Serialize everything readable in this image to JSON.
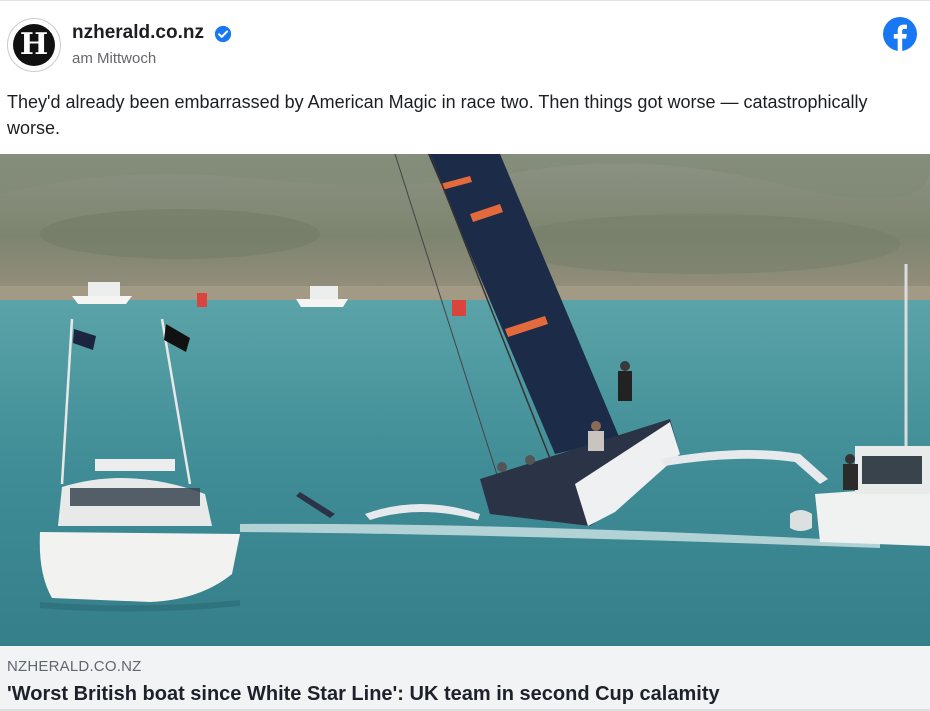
{
  "post": {
    "page_name": "nzherald.co.nz",
    "timestamp": "am Mittwoch",
    "avatar_letter": "H",
    "message": "They'd already been embarrassed by American Magic in race two. Then things got worse — catastrophically worse.",
    "icons": {
      "verified": "verified-badge-icon",
      "platform": "facebook-logo-icon"
    },
    "colors": {
      "verified": "#1877f2",
      "facebook": "#1877f2",
      "footer_bg": "#f2f3f5"
    }
  },
  "link": {
    "domain": "NZHERALD.CO.NZ",
    "title": "'Worst British boat since White Star Line': UK team in second Cup calamity"
  }
}
